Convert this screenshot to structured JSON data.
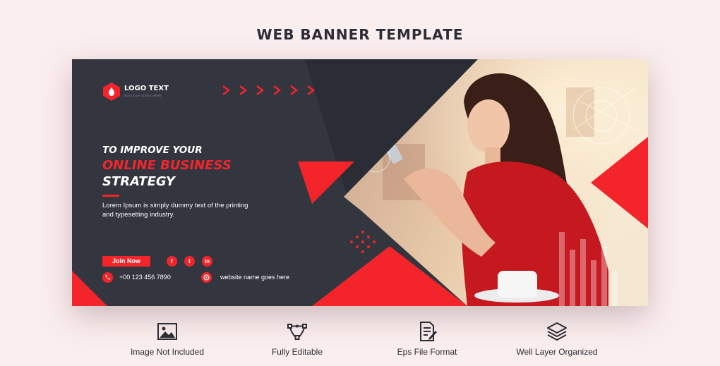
{
  "page": {
    "title": "WEB BANNER TEMPLATE"
  },
  "banner": {
    "logo_text": "LOGO TEXT",
    "logo_slogan": "SOLOGUN GOES HERE",
    "headline_line1": "TO IMPROVE YOUR",
    "headline_line2": "ONLINE BUSINESS",
    "headline_line3": "STRATEGY",
    "body_line1": "Lorem Ipsum is simply dummy text of the printing",
    "body_line2": "and typesetting industry.",
    "join_button": "Join Now",
    "social_icons": [
      "facebook-icon",
      "twitter-icon",
      "linkedin-icon"
    ],
    "social_glyphs": [
      "f",
      "t",
      "in"
    ],
    "phone": "+00 123 456 7890",
    "website": "website name goes here",
    "accent_color": "#f3252b",
    "dark_color": "#33353f"
  },
  "features": [
    {
      "icon": "image-icon",
      "label": "Image Not Included"
    },
    {
      "icon": "vector-edit-icon",
      "label": "Fully Editable"
    },
    {
      "icon": "file-format-icon",
      "label": "Eps File Format"
    },
    {
      "icon": "layers-icon",
      "label": "Well Layer Organized"
    }
  ]
}
